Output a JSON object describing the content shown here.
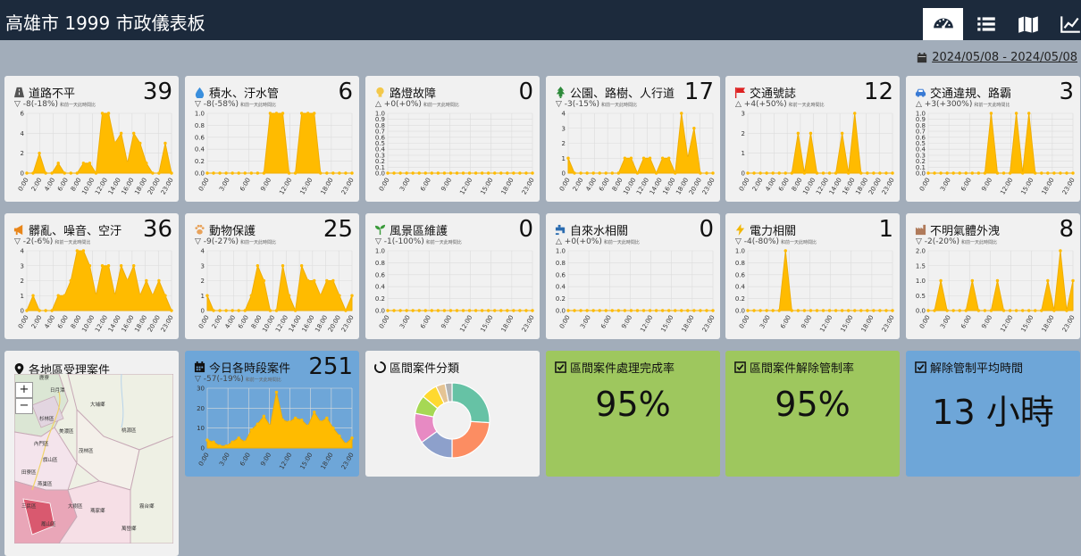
{
  "app_title": "高雄市 1999 市政儀表板",
  "nav": [
    "dashboard-icon",
    "list-icon",
    "map-icon",
    "line-chart-icon"
  ],
  "date_range": "2024/05/08 - 2024/05/08",
  "compare_note": "和前一天此時間比",
  "cards": [
    {
      "id": "road",
      "title": "道路不平",
      "icon": "road-icon",
      "count": "39",
      "sub": "▽ -8(-18%)",
      "y_ticks": [
        "0",
        "2",
        "4",
        "6"
      ],
      "x_ticks": [
        "0:00",
        "2:00",
        "4:00",
        "6:00",
        "8:00",
        "10:00",
        "12:00",
        "14:00",
        "16:00",
        "18:00",
        "20:00",
        "23:00"
      ],
      "ymax": 6,
      "values": [
        0,
        0,
        2,
        0,
        0,
        1,
        0,
        0,
        0,
        1,
        1,
        0,
        6,
        6,
        3,
        4,
        1,
        4,
        3,
        1,
        0,
        0,
        3,
        0
      ]
    },
    {
      "id": "water",
      "title": "積水、汙水管",
      "icon": "drop-icon",
      "count": "6",
      "sub": "▽ -8(-58%)",
      "y_ticks": [
        "0.0",
        "0.2",
        "0.4",
        "0.6",
        "0.8",
        "1.0"
      ],
      "x_ticks": [
        "0:00",
        "3:00",
        "6:00",
        "9:00",
        "12:00",
        "15:00",
        "18:00",
        "23:00"
      ],
      "ymax": 1,
      "values": [
        0,
        0,
        0,
        0,
        0,
        0,
        0,
        0,
        0,
        0,
        1,
        1,
        1,
        0,
        0,
        1,
        1,
        1,
        0,
        0,
        0,
        0,
        0,
        0
      ]
    },
    {
      "id": "light",
      "title": "路燈故障",
      "icon": "bulb-icon",
      "count": "0",
      "sub": "△ +0(+0%)",
      "y_ticks": [
        "0.0",
        "0.1",
        "0.2",
        "0.3",
        "0.4",
        "0.5",
        "0.6",
        "0.7",
        "0.8",
        "0.9",
        "1.0"
      ],
      "x_ticks": [
        "0:00",
        "3:00",
        "6:00",
        "9:00",
        "12:00",
        "15:00",
        "18:00",
        "23:00"
      ],
      "ymax": 1,
      "values": [
        0,
        0,
        0,
        0,
        0,
        0,
        0,
        0,
        0,
        0,
        0,
        0,
        0,
        0,
        0,
        0,
        0,
        0,
        0,
        0,
        0,
        0,
        0,
        0
      ]
    },
    {
      "id": "park",
      "title": "公園、路樹、人行道",
      "icon": "tree-icon",
      "count": "17",
      "sub": "▽ -3(-15%)",
      "y_ticks": [
        "0",
        "1",
        "2",
        "3",
        "4"
      ],
      "x_ticks": [
        "0:00",
        "2:00",
        "4:00",
        "6:00",
        "8:00",
        "10:00",
        "12:00",
        "14:00",
        "16:00",
        "18:00",
        "20:00",
        "23:00"
      ],
      "ymax": 4,
      "values": [
        1,
        0,
        0,
        0,
        0,
        0,
        0,
        0,
        0,
        1,
        1,
        0,
        1,
        1,
        0,
        1,
        1,
        0,
        4,
        1,
        3,
        0,
        0,
        0
      ]
    },
    {
      "id": "traffic_sign",
      "title": "交通號誌",
      "icon": "flag-icon",
      "count": "12",
      "sub": "△ +4(+50%)",
      "y_ticks": [
        "0",
        "1",
        "2",
        "3"
      ],
      "x_ticks": [
        "0:00",
        "2:00",
        "4:00",
        "6:00",
        "8:00",
        "10:00",
        "12:00",
        "14:00",
        "16:00",
        "18:00",
        "20:00",
        "23:00"
      ],
      "ymax": 3,
      "values": [
        0,
        0,
        0,
        0,
        0,
        0,
        0,
        0,
        2,
        0,
        2,
        0,
        0,
        0,
        0,
        2,
        0,
        3,
        0,
        0,
        0,
        0,
        0,
        0
      ]
    },
    {
      "id": "violation",
      "title": "交通違規、路霸",
      "icon": "car-icon",
      "count": "3",
      "sub": "△ +3(+300%)",
      "y_ticks": [
        "0.0",
        "0.1",
        "0.2",
        "0.3",
        "0.4",
        "0.5",
        "0.6",
        "0.7",
        "0.8",
        "0.9",
        "1.0"
      ],
      "x_ticks": [
        "0:00",
        "3:00",
        "6:00",
        "9:00",
        "12:00",
        "15:00",
        "18:00",
        "23:00"
      ],
      "ymax": 1,
      "values": [
        0,
        0,
        0,
        0,
        0,
        0,
        0,
        0,
        0,
        0,
        1,
        0,
        0,
        0,
        1,
        0,
        1,
        0,
        0,
        0,
        0,
        0,
        0,
        0
      ]
    },
    {
      "id": "noise",
      "title": "髒亂、噪音、空汙",
      "icon": "megaphone-icon",
      "count": "36",
      "sub": "▽ -2(-6%)",
      "y_ticks": [
        "0",
        "1",
        "2",
        "3",
        "4"
      ],
      "x_ticks": [
        "0:00",
        "2:00",
        "4:00",
        "6:00",
        "8:00",
        "10:00",
        "12:00",
        "14:00",
        "16:00",
        "18:00",
        "20:00",
        "23:00"
      ],
      "ymax": 4,
      "values": [
        0,
        1,
        0,
        0,
        0,
        1,
        1,
        2,
        4,
        4,
        3,
        1,
        3,
        3,
        1,
        3,
        2,
        3,
        1,
        2,
        1,
        2,
        1,
        0
      ]
    },
    {
      "id": "animal",
      "title": "動物保護",
      "icon": "paw-icon",
      "count": "25",
      "sub": "▽ -9(-27%)",
      "y_ticks": [
        "0",
        "1",
        "2",
        "3",
        "4"
      ],
      "x_ticks": [
        "0:00",
        "2:00",
        "4:00",
        "6:00",
        "8:00",
        "10:00",
        "12:00",
        "14:00",
        "16:00",
        "18:00",
        "20:00",
        "23:00"
      ],
      "ymax": 4,
      "values": [
        1,
        0,
        0,
        0,
        0,
        0,
        0,
        1,
        3,
        2,
        0,
        0,
        3,
        1,
        0,
        3,
        2,
        2,
        1,
        2,
        2,
        1,
        0,
        1
      ]
    },
    {
      "id": "scenic",
      "title": "風景區維護",
      "icon": "sprout-icon",
      "count": "0",
      "sub": "▽ -1(-100%)",
      "y_ticks": [
        "0.0",
        "0.2",
        "0.4",
        "0.6",
        "0.8",
        "1.0"
      ],
      "x_ticks": [
        "0:00",
        "3:00",
        "6:00",
        "9:00",
        "12:00",
        "15:00",
        "18:00",
        "23:00"
      ],
      "ymax": 1,
      "values": [
        0,
        0,
        0,
        0,
        0,
        0,
        0,
        0,
        0,
        0,
        0,
        0,
        0,
        0,
        0,
        0,
        0,
        0,
        0,
        0,
        0,
        0,
        0,
        0
      ]
    },
    {
      "id": "tapwater",
      "title": "自來水相關",
      "icon": "faucet-icon",
      "count": "0",
      "sub": "△ +0(+0%)",
      "y_ticks": [
        "0.0",
        "0.2",
        "0.4",
        "0.6",
        "0.8",
        "1.0"
      ],
      "x_ticks": [
        "0:00",
        "3:00",
        "6:00",
        "9:00",
        "12:00",
        "15:00",
        "18:00",
        "23:00"
      ],
      "ymax": 1,
      "values": [
        0,
        0,
        0,
        0,
        0,
        0,
        0,
        0,
        0,
        0,
        0,
        0,
        0,
        0,
        0,
        0,
        0,
        0,
        0,
        0,
        0,
        0,
        0,
        0
      ]
    },
    {
      "id": "power",
      "title": "電力相關",
      "icon": "bolt-icon",
      "count": "1",
      "sub": "▽ -4(-80%)",
      "y_ticks": [
        "0.0",
        "0.2",
        "0.4",
        "0.6",
        "0.8",
        "1.0"
      ],
      "x_ticks": [
        "0:00",
        "3:00",
        "6:00",
        "9:00",
        "12:00",
        "15:00",
        "18:00",
        "23:00"
      ],
      "ymax": 1,
      "values": [
        0,
        0,
        0,
        0,
        0,
        0,
        1,
        0,
        0,
        0,
        0,
        0,
        0,
        0,
        0,
        0,
        0,
        0,
        0,
        0,
        0,
        0,
        0,
        0
      ]
    },
    {
      "id": "gas",
      "title": "不明氣體外洩",
      "icon": "factory-icon",
      "count": "8",
      "sub": "▽ -2(-20%)",
      "y_ticks": [
        "0.0",
        "0.5",
        "1.0",
        "1.5",
        "2.0"
      ],
      "x_ticks": [
        "0:00",
        "3:00",
        "6:00",
        "9:00",
        "12:00",
        "15:00",
        "18:00",
        "23:00"
      ],
      "ymax": 2,
      "values": [
        0,
        0,
        1,
        0,
        0,
        0,
        0,
        1,
        0,
        0,
        0,
        1,
        0,
        0,
        0,
        0,
        0,
        0,
        0,
        1,
        0,
        2,
        0,
        1
      ]
    }
  ],
  "map_card": {
    "title": "各地區受理案件",
    "zoom_in": "+",
    "zoom_out": "−",
    "places": [
      "鹿寮",
      "日月潭",
      "大埔鄉",
      "杉林區",
      "桃源區",
      "美濃區",
      "內門區",
      "茂林區",
      "旗山區",
      "田寮區",
      "燕巢區",
      "三民區",
      "鳳山區",
      "大樹區",
      "瑪家鄉",
      "霧台鄉",
      "萬巒鄉"
    ]
  },
  "daily_card": {
    "title": "今日各時段案件",
    "count": "251",
    "sub": "▽ -57(-19%)",
    "y_ticks": [
      "0",
      "10",
      "20",
      "30"
    ],
    "x_ticks": [
      "0:00",
      "3:00",
      "6:00",
      "9:00",
      "12:00",
      "15:00",
      "18:00",
      "23:00"
    ],
    "ymax": 30,
    "values": [
      4,
      3,
      1,
      1,
      3,
      5,
      3,
      9,
      12,
      16,
      11,
      28,
      14,
      13,
      15,
      14,
      11,
      18,
      13,
      15,
      10,
      6,
      2,
      5
    ]
  },
  "donut_card": {
    "title": "區間案件分類",
    "chart_data": {
      "type": "pie",
      "values": [
        26,
        24,
        15,
        13,
        8,
        7,
        4,
        3
      ]
    },
    "colors": [
      "#66c2a5",
      "#fc8d62",
      "#8da0cb",
      "#e78ac3",
      "#a6d854",
      "#ffd92f",
      "#e5c494",
      "#b3b3b3"
    ]
  },
  "kpis": [
    {
      "id": "complete",
      "title": "區間案件處理完成率",
      "value": "95%"
    },
    {
      "id": "release",
      "title": "區間案件解除管制率",
      "value": "95%"
    },
    {
      "id": "avg_time",
      "title": "解除管制平均時間",
      "value": "13 小時"
    }
  ]
}
